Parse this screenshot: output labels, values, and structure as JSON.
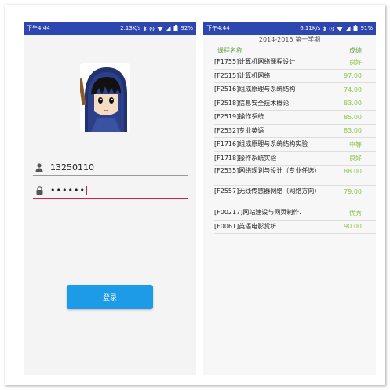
{
  "login_screen": {
    "status_bar": {
      "time": "下午4:44",
      "speed": "2.13K/s",
      "battery": "92%"
    },
    "username": "13250110",
    "password_mask": "••••••",
    "login_button": "登录"
  },
  "grades_screen": {
    "status_bar": {
      "time": "下午4:44",
      "speed": "6.11K/s",
      "battery": "91%"
    },
    "term": "2014-2015 第一学期",
    "header": {
      "course": "课程名称",
      "grade": "成绩"
    },
    "rows": [
      {
        "course": "[F1755]计算机网络课程设计",
        "grade": "良好"
      },
      {
        "course": "[F2515]计算机网络",
        "grade": "97.00"
      },
      {
        "course": "[F2516]组成原理与系统结构",
        "grade": "74.00"
      },
      {
        "course": "[F2518]信息安全技术概论",
        "grade": "83.00"
      },
      {
        "course": "[F2519]操作系统",
        "grade": "85.00"
      },
      {
        "course": "[F2532]专业英语",
        "grade": "83.00"
      },
      {
        "course": "[F1716]组成原理与系统结构实验",
        "grade": "中等"
      },
      {
        "course": "[F1718]操作系统实验",
        "grade": "良好"
      },
      {
        "course": "[F2535]网络规划与设计（专业任选）",
        "grade": "88.00"
      },
      {
        "course": "[F2557]无线传感器网络（网络方向）",
        "grade": "79.00"
      },
      {
        "course": "[F00217]网站建设与网页制作.",
        "grade": "优秀"
      },
      {
        "course": "[F0061]英语电影赏析",
        "grade": "90.00"
      }
    ]
  },
  "colors": {
    "status_bar": "#2e47b0",
    "accent_pink": "#d81b60",
    "button_blue": "#1e9be6",
    "grade_green": "#8bc34a"
  },
  "icons": [
    "bluetooth-icon",
    "alarm-icon",
    "wifi-icon",
    "signal-icon",
    "battery-icon",
    "user-icon",
    "lock-icon"
  ]
}
